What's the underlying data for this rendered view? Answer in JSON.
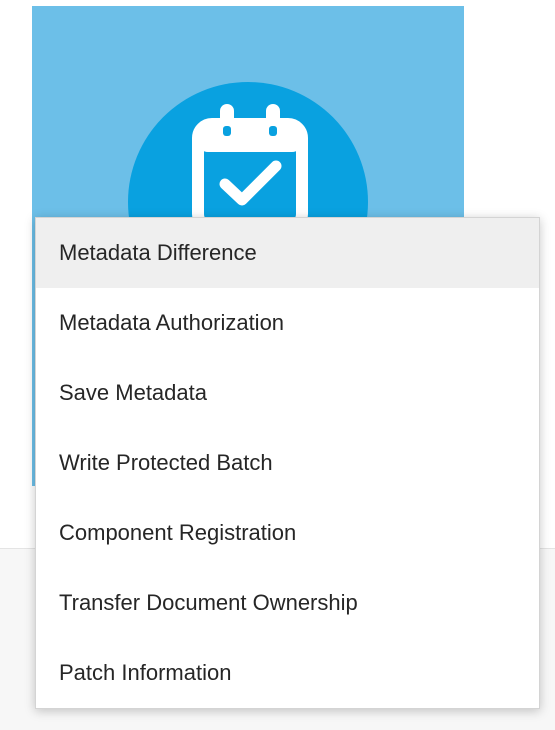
{
  "tile": {
    "icon": "calendar-check-icon",
    "background_color": "#6cbfe8",
    "circle_color": "#09a1e0",
    "icon_color": "#ffffff"
  },
  "menu": {
    "items": [
      {
        "label": "Metadata Difference",
        "highlighted": true
      },
      {
        "label": "Metadata Authorization"
      },
      {
        "label": "Save Metadata"
      },
      {
        "label": "Write Protected Batch"
      },
      {
        "label": "Component Registration"
      },
      {
        "label": "Transfer Document Ownership"
      },
      {
        "label": "Patch Information"
      }
    ]
  }
}
